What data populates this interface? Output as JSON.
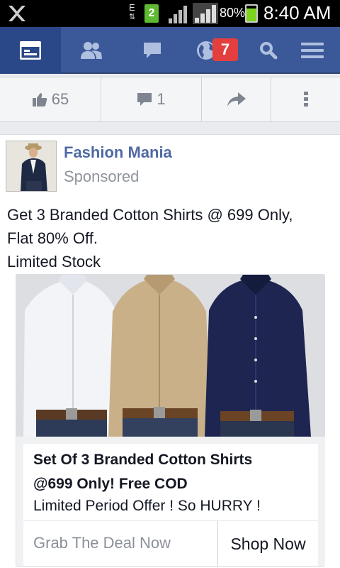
{
  "status_bar": {
    "network_type_top": "E",
    "network_type_bottom": "⇅",
    "sim_slot": "2",
    "battery_percent": "80%",
    "battery_level": 0.8,
    "time": "8:40 AM"
  },
  "navbar": {
    "notifications_badge": "7"
  },
  "action_bar": {
    "like_count": "65",
    "comment_count": "1"
  },
  "post": {
    "page_name": "Fashion Mania",
    "sponsored_label": "Sponsored",
    "text_line1": "Get 3 Branded Cotton Shirts @ 699 Only,",
    "text_line2": "Flat 80% Off.",
    "text_line3": "Limited Stock",
    "ad": {
      "title_line1": "Set Of 3 Branded Cotton Shirts",
      "title_line2": "@699 Only! Free COD",
      "description": "Limited Period Offer ! So HURRY !",
      "link_text": "Grab The Deal Now",
      "cta_label": "Shop Now"
    }
  },
  "colors": {
    "nav_blue": "#3b5998",
    "nav_active": "#2a4887",
    "badge_red": "#e43f3f",
    "link_blue": "#4f6aa3"
  },
  "icons": [
    "app-logo-icon",
    "signal-icon",
    "battery-icon",
    "news-feed-icon",
    "friends-icon",
    "messages-icon",
    "globe-icon",
    "search-icon",
    "menu-icon",
    "like-icon",
    "comment-icon",
    "share-icon",
    "more-icon"
  ]
}
